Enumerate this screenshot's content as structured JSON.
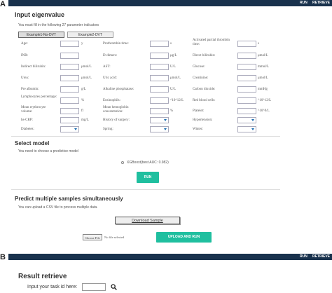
{
  "panel_a": {
    "letter": "A",
    "navbar": {
      "run": "RUN",
      "retrieve": "RETRIEVE"
    },
    "title": "Input eigenvalue",
    "instruction": "You must fill in the following 27 parameter indicators",
    "tabs": [
      "Example1-No-DVT",
      "Example2-DVT"
    ],
    "fields": [
      {
        "label": "Age:",
        "unit": "y"
      },
      {
        "label": "Prothrombin time:",
        "unit": "s"
      },
      {
        "label": "Activated partial thrombin time:",
        "unit": "s"
      },
      {
        "label": "INR:",
        "unit": ""
      },
      {
        "label": "D-dimers:",
        "unit": "μg/L"
      },
      {
        "label": "Direct bilirubin:",
        "unit": "μmol/L"
      },
      {
        "label": "Indirect bilirubin:",
        "unit": "μmol/L"
      },
      {
        "label": "AST:",
        "unit": "U/L"
      },
      {
        "label": "Glucose:",
        "unit": "mmol/L"
      },
      {
        "label": "Urea:",
        "unit": "μmol/L"
      },
      {
        "label": "Uric acid:",
        "unit": "μmol/L"
      },
      {
        "label": "Creatinine:",
        "unit": "μmol/L"
      },
      {
        "label": "Pre albumin:",
        "unit": "g/L"
      },
      {
        "label": "Alkaline phosphatase:",
        "unit": "U/L"
      },
      {
        "label": "Carbon dioxide:",
        "unit": "mmHg"
      },
      {
        "label": "Lymphocytes percentage:",
        "unit": "%"
      },
      {
        "label": "Eosinophils:",
        "unit": "^10^12/L"
      },
      {
        "label": "Red blood cells:",
        "unit": "^10^12/L"
      },
      {
        "label": "Mean erythrocyte volume:",
        "unit": "fl"
      },
      {
        "label": "Mean hemoglobin concentration:",
        "unit": "%"
      },
      {
        "label": "Platelet:",
        "unit": "^10^9/L"
      },
      {
        "label": "hs-CRP:",
        "unit": "mg/L"
      }
    ],
    "selects": [
      {
        "label": "History of surgery:"
      },
      {
        "label": "Hypertension:"
      },
      {
        "label": "Diabetes:"
      },
      {
        "label": "Spring:"
      },
      {
        "label": "Winter:"
      }
    ],
    "select_model": {
      "title": "Select model",
      "instruction": "You need to choose a predictive model",
      "option": "XGBoost(best AUC: 0.982)",
      "run_button": "RUN"
    },
    "predict_multiple": {
      "title": "Predict multiple samples simultaneously",
      "instruction": "You can upload a CSV file to process multiple data.",
      "download_button": "Download Sample",
      "choose_file": "Choose File",
      "file_status": "No file selected",
      "upload_button": "UPLOAD AND RUN"
    }
  },
  "panel_b": {
    "letter": "B",
    "navbar": {
      "run": "RUN",
      "retrieve": "RETRIEVE"
    },
    "title": "Result retrieve",
    "task_label": "Input your task id here:"
  }
}
